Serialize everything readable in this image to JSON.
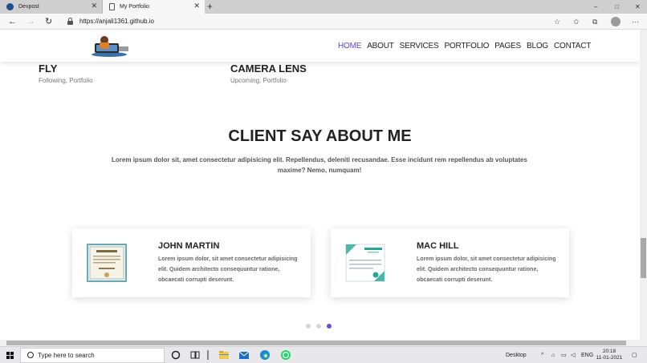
{
  "browser": {
    "tabs": [
      {
        "title": "Devpost",
        "active": false
      },
      {
        "title": "My Portfolio",
        "active": true
      }
    ],
    "url": "https://anjali1361.github.io",
    "window_controls": {
      "minimize": "–",
      "maximize": "□",
      "close": "✕"
    }
  },
  "site": {
    "nav": [
      {
        "label": "HOME",
        "active": true
      },
      {
        "label": "ABOUT",
        "active": false
      },
      {
        "label": "SERVICES",
        "active": false
      },
      {
        "label": "PORTFOLIO",
        "active": false
      },
      {
        "label": "PAGES",
        "active": false
      },
      {
        "label": "BLOG",
        "active": false
      },
      {
        "label": "CONTACT",
        "active": false
      }
    ],
    "portfolio_items": [
      {
        "title": "FLY",
        "subtitle": "Following, Portfolio"
      },
      {
        "title": "CAMERA LENS",
        "subtitle": "Upcoming, Portfolio"
      }
    ],
    "testimonials": {
      "title": "CLIENT SAY ABOUT ME",
      "intro": "Lorem ipsum dolor sit, amet consectetur adipisicing elit. Repellendus, deleniti recusandae. Esse incidunt rem repellendus ab voluptates maxime? Nemo, numquam!",
      "cards": [
        {
          "name": "JOHN MARTIN",
          "text": "Lorem ipsum dolor, sit amet consectetur adipisicing elit. Quidem architecto consequuntur ratione, obcaecati corrupti deserunt."
        },
        {
          "name": "MAC HILL",
          "text": "Lorem ipsum dolor, sit amet consectetur adipisicing elit. Quidem architecto consequuntur ratione, obcaecati corrupti deserunt."
        }
      ],
      "slider_dots": 3,
      "active_dot": 3
    },
    "accent_color": "#6a4fd8"
  },
  "taskbar": {
    "search_placeholder": "Type here to search",
    "desktop_label": "Desktop",
    "language": "ENG",
    "time": "20:18",
    "date": "11-01-2021"
  }
}
